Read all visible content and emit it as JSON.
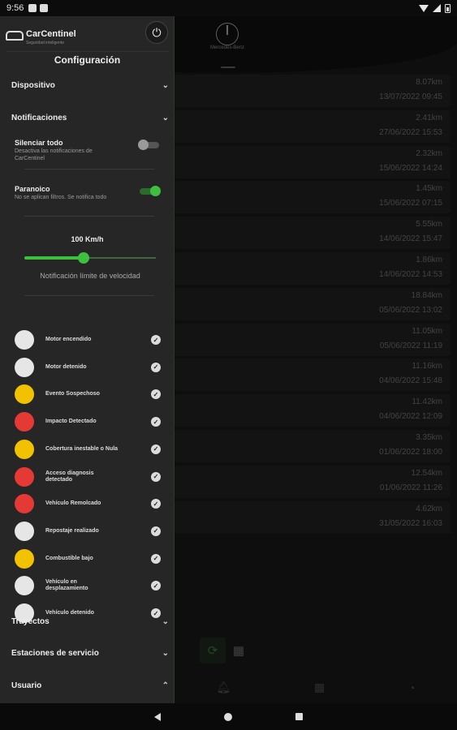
{
  "status_bar": {
    "time": "9:56"
  },
  "app": {
    "brand_name": "Mercedes-Benz"
  },
  "trips": [
    {
      "km": "8.07km",
      "date": "13/07/2022 09:45"
    },
    {
      "km": "2.41km",
      "date": "27/06/2022 15:53"
    },
    {
      "km": "2.32km",
      "date": "15/06/2022 14:24"
    },
    {
      "km": "1.45km",
      "date": "15/06/2022 07:15"
    },
    {
      "km": "5.55km",
      "date": "14/06/2022 15:47"
    },
    {
      "km": "1.86km",
      "date": "14/06/2022 14:53"
    },
    {
      "km": "18.84km",
      "date": "05/06/2022 13:02"
    },
    {
      "km": "11.05km",
      "date": "05/06/2022 11:19"
    },
    {
      "km": "11.16km",
      "date": "04/06/2022 15:48"
    },
    {
      "km": "11.42km",
      "date": "04/06/2022 12:09"
    },
    {
      "km": "3.35km",
      "date": "01/06/2022 18:00"
    },
    {
      "km": "12.54km",
      "date": "01/06/2022 11:26"
    },
    {
      "km": "4.62km",
      "date": "31/05/2022 16:03"
    }
  ],
  "drawer": {
    "logo_name": "CarCentinel",
    "logo_sub": "Seguridad inteligente",
    "title": "Configuración",
    "sections": {
      "device": "Dispositivo",
      "notifications": "Notificaciones",
      "trips": "Trayectos",
      "stations": "Estaciones de servicio",
      "user": "Usuario"
    },
    "mute_all": {
      "title": "Silenciar todo",
      "desc": "Desactiva las notificaciones de CarCentinel",
      "on": false
    },
    "paranoid": {
      "title": "Paranoico",
      "desc": "No se aplican filtros. Se notifica todo",
      "on": true
    },
    "speed": {
      "value": "100 Km/h",
      "label": "Notificación límite de velocidad",
      "level": 0.45
    },
    "notifications": [
      {
        "label": "Motor encendido",
        "icon": "engine-on-icon",
        "color": "#e6e6e6"
      },
      {
        "label": "Motor detenido",
        "icon": "engine-off-icon",
        "color": "#e6e6e6"
      },
      {
        "label": "Evento Sospechoso",
        "icon": "warning-icon",
        "color": "#f2c200"
      },
      {
        "label": "Impacto Detectado",
        "icon": "crash-icon",
        "color": "#e53935"
      },
      {
        "label": "Cobertura inestable o Nula",
        "icon": "coverage-icon",
        "color": "#f2c200"
      },
      {
        "label": "Acceso diagnosis detectado",
        "icon": "diagnosis-icon",
        "color": "#e53935"
      },
      {
        "label": "Vehículo Remolcado",
        "icon": "tow-icon",
        "color": "#e53935"
      },
      {
        "label": "Repostaje realizado",
        "icon": "refuel-icon",
        "color": "#e6e6e6"
      },
      {
        "label": "Combustible bajo",
        "icon": "low-fuel-icon",
        "color": "#f2c200"
      },
      {
        "label": "Vehículo en desplazamiento",
        "icon": "moving-car-icon",
        "color": "#e6e6e6"
      },
      {
        "label": "Vehículo detenido",
        "icon": "stopped-car-icon",
        "color": "#e6e6e6"
      }
    ]
  }
}
